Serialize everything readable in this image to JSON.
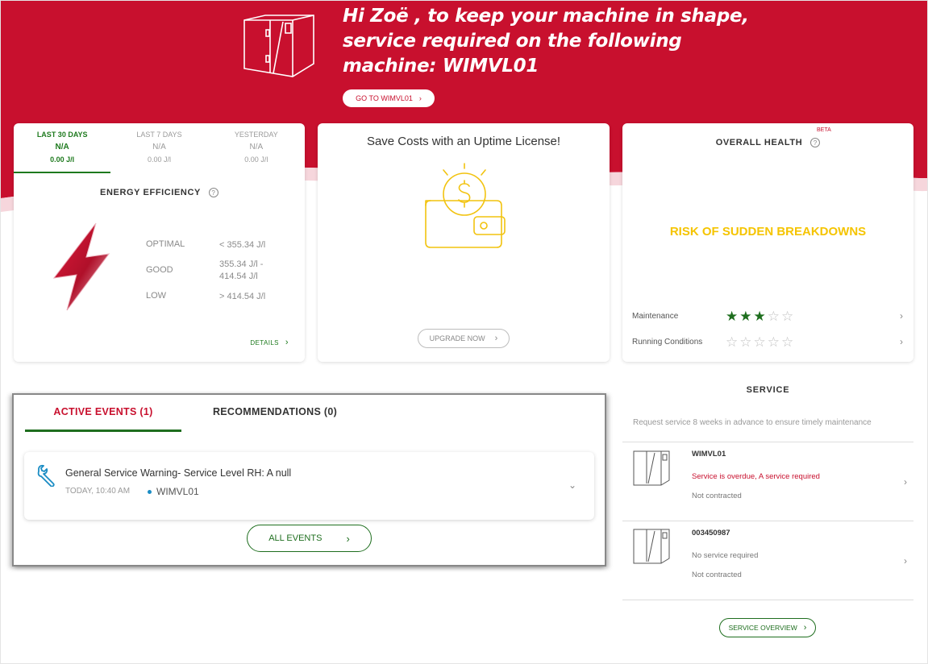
{
  "hero": {
    "title": "Hi Zoë , to keep your machine in shape, service required on the following machine: WIMVL01",
    "goto_label": "GO TO WIMVL01",
    "brand_color": "#c8102e"
  },
  "energy": {
    "tabs": [
      {
        "label": "LAST 30 DAYS",
        "value": "N/A",
        "sub": "0.00 J/l",
        "active": true
      },
      {
        "label": "LAST 7 DAYS",
        "value": "N/A",
        "sub": "0.00 J/l",
        "active": false
      },
      {
        "label": "YESTERDAY",
        "value": "N/A",
        "sub": "0.00 J/l",
        "active": false
      }
    ],
    "heading": "ENERGY EFFICIENCY",
    "levels": [
      {
        "label": "OPTIMAL",
        "value": "< 355.34 J/l"
      },
      {
        "label": "GOOD",
        "value": "355.34 J/l - 414.54 J/l"
      },
      {
        "label": "LOW",
        "value": "> 414.54 J/l"
      }
    ],
    "details_label": "DETAILS"
  },
  "uptime": {
    "title": "Save Costs with an Uptime License!",
    "upgrade_label": "UPGRADE NOW",
    "icon": "wallet-coin-icon"
  },
  "health": {
    "beta": "BETA",
    "heading": "OVERALL HEALTH",
    "status": "RISK OF SUDDEN BREAKDOWNS",
    "status_color": "#f5c400",
    "ratings": [
      {
        "label": "Maintenance",
        "stars": 3,
        "max": 5
      },
      {
        "label": "Running Conditions",
        "stars": 0,
        "max": 5
      }
    ]
  },
  "events": {
    "tabs": [
      "ACTIVE EVENTS (1)",
      "RECOMMENDATIONS (0)"
    ],
    "items": [
      {
        "title": "General Service Warning- Service Level RH: A null",
        "time": "TODAY, 10:40 AM",
        "machine": "WIMVL01"
      }
    ],
    "all_label": "ALL EVENTS"
  },
  "service": {
    "heading": "SERVICE",
    "note": "Request service 8 weeks in advance to ensure timely maintenance",
    "machines": [
      {
        "name": "WIMVL01",
        "status": "Service is overdue, A service required",
        "status_color": "#c8102e",
        "contract": "Not contracted"
      },
      {
        "name": "003450987",
        "status": "No service required",
        "status_color": "#777777",
        "contract": "Not contracted"
      }
    ],
    "overview_label": "SERVICE OVERVIEW"
  }
}
